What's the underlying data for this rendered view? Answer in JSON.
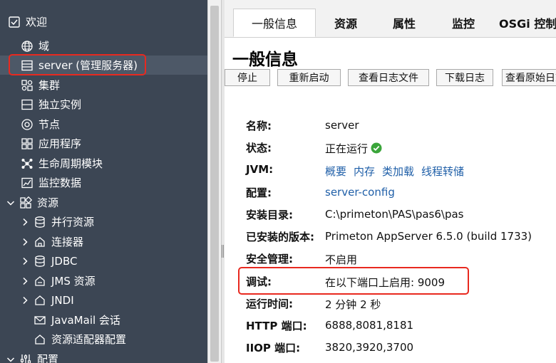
{
  "sidebar": {
    "items": [
      {
        "label": "欢迎",
        "icon": "checklist-icon"
      },
      {
        "label": "域",
        "icon": "globe-icon"
      },
      {
        "label": "server (管理服务器)",
        "icon": "server-icon"
      },
      {
        "label": "集群",
        "icon": "cluster-icon"
      },
      {
        "label": "独立实例",
        "icon": "instance-icon"
      },
      {
        "label": "节点",
        "icon": "node-icon"
      },
      {
        "label": "应用程序",
        "icon": "apps-icon"
      },
      {
        "label": "生命周期模块",
        "icon": "lifecycle-icon"
      },
      {
        "label": "监控数据",
        "icon": "monitor-chart-icon"
      },
      {
        "label": "资源",
        "icon": "resources-icon"
      },
      {
        "label": "并行资源",
        "icon": "database-icon"
      },
      {
        "label": "连接器",
        "icon": "connector-icon"
      },
      {
        "label": "JDBC",
        "icon": "database-icon"
      },
      {
        "label": "JMS 资源",
        "icon": "jms-icon"
      },
      {
        "label": "JNDI",
        "icon": "jndi-icon"
      },
      {
        "label": "JavaMail 会话",
        "icon": "mail-icon"
      },
      {
        "label": "资源适配器配置",
        "icon": "adapter-icon"
      },
      {
        "label": "配置",
        "icon": "settings-sliders-icon"
      }
    ]
  },
  "tabs": [
    {
      "label": "一般信息"
    },
    {
      "label": "资源"
    },
    {
      "label": "属性"
    },
    {
      "label": "监控"
    },
    {
      "label": "OSGi 控制"
    }
  ],
  "page": {
    "title": "一般信息"
  },
  "toolbar": {
    "buttons": [
      {
        "label": "停止"
      },
      {
        "label": "重新启动"
      },
      {
        "label": "查看日志文件"
      },
      {
        "label": "下载日志"
      },
      {
        "label": "查看原始日志"
      }
    ]
  },
  "properties": {
    "name": {
      "label": "名称:",
      "value": "server"
    },
    "status": {
      "label": "状态:",
      "value": "正在运行"
    },
    "jvm": {
      "label": "JVM:",
      "links": [
        "概要",
        "内存",
        "类加载",
        "线程转储"
      ]
    },
    "config": {
      "label": "配置:",
      "value": "server-config"
    },
    "install_dir": {
      "label": "安装目录:",
      "value": "C:\\primeton\\PAS\\pas6\\pas"
    },
    "version": {
      "label": "已安装的版本:",
      "value": "Primeton AppServer 6.5.0 (build 1733)"
    },
    "security": {
      "label": "安全管理:",
      "value": "不启用"
    },
    "debug": {
      "label": "调试:",
      "value": "在以下端口上启用: 9009"
    },
    "uptime": {
      "label": "运行时间:",
      "value": "2 分钟 2 秒"
    },
    "http_port": {
      "label": "HTTP 端口:",
      "value": "6888,8081,8181"
    },
    "iiop_port": {
      "label": "IIOP 端口:",
      "value": "3820,3920,3700"
    }
  },
  "colors": {
    "sidebar_bg": "#3c4654",
    "highlight": "#e8291f",
    "link": "#1f5fa8",
    "ok": "#3aa53a"
  }
}
